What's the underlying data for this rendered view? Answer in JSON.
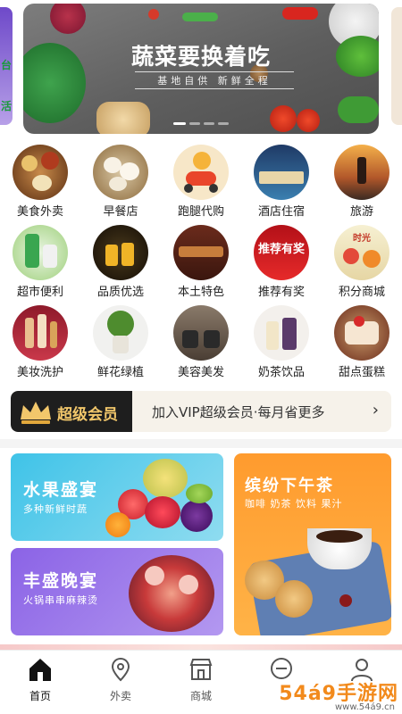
{
  "banner": {
    "title": "蔬菜要换着吃",
    "subtitle": "基地自供 新鲜全程",
    "side_left_text": [
      "台",
      "活"
    ]
  },
  "categories": [
    {
      "label": "美食外卖",
      "icon": "food-delivery-photo"
    },
    {
      "label": "早餐店",
      "icon": "breakfast-photo"
    },
    {
      "label": "跑腿代购",
      "icon": "courier-scooter-icon"
    },
    {
      "label": "酒店住宿",
      "icon": "hotel-photo"
    },
    {
      "label": "旅游",
      "icon": "travel-pagoda-photo"
    },
    {
      "label": "超市便利",
      "icon": "supermarket-photo"
    },
    {
      "label": "品质优选",
      "icon": "quality-beer-photo"
    },
    {
      "label": "本土特色",
      "icon": "local-specialty-photo"
    },
    {
      "label": "推荐有奖",
      "icon": "referral-reward-photo",
      "overlay": "推荐有奖"
    },
    {
      "label": "积分商城",
      "icon": "points-mall-photo",
      "overlay": "时光"
    },
    {
      "label": "美妆洗护",
      "icon": "cosmetics-photo"
    },
    {
      "label": "鲜花绿植",
      "icon": "plant-photo"
    },
    {
      "label": "美容美发",
      "icon": "salon-photo"
    },
    {
      "label": "奶茶饮品",
      "icon": "milk-tea-photo"
    },
    {
      "label": "甜点蛋糕",
      "icon": "cake-photo"
    }
  ],
  "vip": {
    "badge": "超级会员",
    "text": "加入VIP超级会员·每月省更多",
    "arrow": "›"
  },
  "promos": {
    "fruit": {
      "title": "水果盛宴",
      "subtitle": "多种新鲜时蔬"
    },
    "dinner": {
      "title": "丰盛晚宴",
      "subtitle": "火锅串串麻辣烫"
    },
    "tea": {
      "title": "缤纷下午茶",
      "subtitle": "咖啡 奶茶 饮料 果汁"
    }
  },
  "bottom_nav": [
    {
      "label": "首页",
      "icon": "home-icon",
      "active": true
    },
    {
      "label": "外卖",
      "icon": "location-pin-icon",
      "active": false
    },
    {
      "label": "商城",
      "icon": "shop-icon",
      "active": false
    },
    {
      "label": "",
      "icon": "message-icon",
      "active": false
    },
    {
      "label": "",
      "icon": "user-icon",
      "active": false
    }
  ],
  "watermark": {
    "main": "54á9手游网",
    "sub": "www.54á9.cn"
  },
  "colors": {
    "vip_gold": "#f2c76b",
    "fruit_card": "#3fc3e8",
    "dinner_card": "#8b63e6",
    "tea_card": "#ff9b2e"
  }
}
